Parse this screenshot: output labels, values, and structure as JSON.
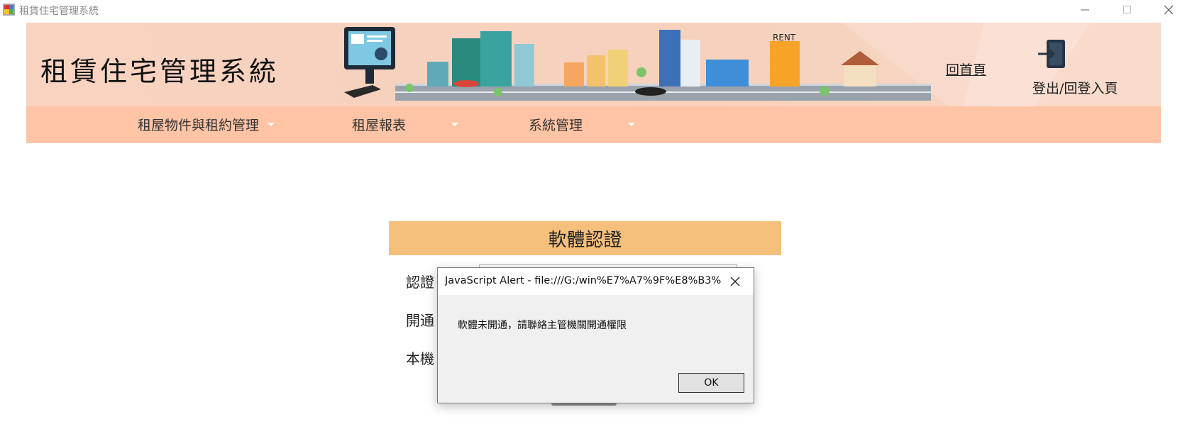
{
  "window": {
    "title": "租賃住宅管理系統",
    "icon": "app-window-icon"
  },
  "header": {
    "brand": "租賃住宅管理系統",
    "home_link": "回首頁",
    "logout_label": "登出/回登入頁",
    "rent_sign": "RENT"
  },
  "nav": {
    "items": [
      {
        "label": "租屋物件與租約管理"
      },
      {
        "label": "租屋報表"
      },
      {
        "label": "系統管理"
      }
    ]
  },
  "panel": {
    "title": "軟體認證",
    "labels": [
      "認證",
      "開通",
      "本機"
    ]
  },
  "alert": {
    "title": "JavaScript Alert - file:///G:/win%E7%A7%9F%E8%B3%8...",
    "message": "軟體未開通，請聯絡主管機關開通權限",
    "ok_label": "OK"
  },
  "colors": {
    "header_bg": "#f7d3c0",
    "nav_bg": "#fec4a5",
    "panel_head_bg": "#f5c07c",
    "dialog_bg": "#f0f0f0"
  }
}
